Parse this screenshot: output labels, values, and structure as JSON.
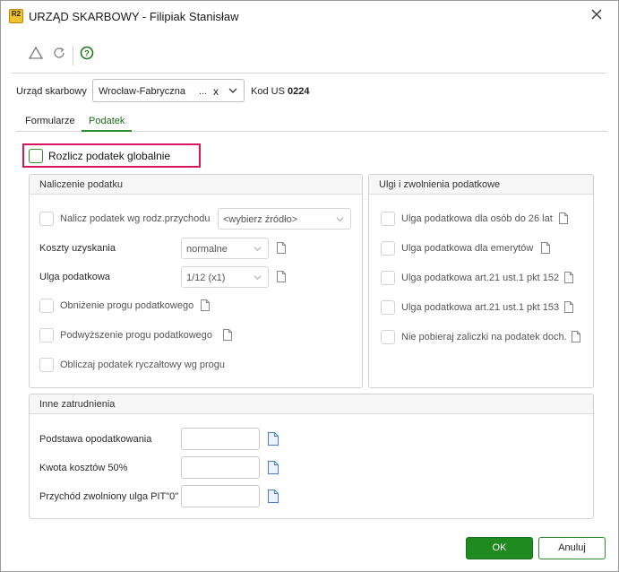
{
  "window": {
    "title": "URZĄD SKARBOWY - Filipiak Stanisław",
    "logo_text": "R2"
  },
  "header": {
    "us_label": "Urząd skarbowy",
    "us_value": "Wrocław-Fabryczna",
    "us_ellipsis": "...",
    "us_clear": "x",
    "kod_label": "Kod US",
    "kod_value": "0224"
  },
  "tabs": [
    {
      "label": "Formularze"
    },
    {
      "label": "Podatek"
    }
  ],
  "global": {
    "label": "Rozlicz podatek globalnie",
    "highlight_color": "#d6175f"
  },
  "naliczenie": {
    "title": "Naliczenie podatku",
    "wg_rodz_label": "Nalicz podatek wg rodz.przychodu",
    "zrodlo_value": "<wybierz źródło>",
    "koszty_label": "Koszty uzyskania",
    "koszty_value": "normalne",
    "ulga_label": "Ulga podatkowa",
    "ulga_value": "1/12 (x1)",
    "obnizenie_label": "Obniżenie progu podatkowego",
    "podwyzszenie_label": "Podwyższenie progu podatkowego",
    "ryczaltowy_label": "Obliczaj podatek ryczałtowy wg progu"
  },
  "ulgi": {
    "title": "Ulgi i zwolnienia podatkowe",
    "items": [
      {
        "label": "Ulga podatkowa dla osób do 26 lat"
      },
      {
        "label": "Ulga podatkowa dla emerytów"
      },
      {
        "label": "Ulga podatkowa art.21 ust.1 pkt 152"
      },
      {
        "label": "Ulga podatkowa art.21 ust.1 pkt 153"
      },
      {
        "label": "Nie pobieraj zaliczki na podatek doch."
      }
    ]
  },
  "inne": {
    "title": "Inne zatrudnienia",
    "podstawa_label": "Podstawa opodatkowania",
    "kwota_label": "Kwota kosztów 50%",
    "przychod_label": "Przychód zwolniony ulga PIT\"0\""
  },
  "buttons": {
    "ok": "OK",
    "cancel": "Anuluj"
  },
  "colors": {
    "accent": "#2e8b2e",
    "ok_bg": "#1f8a1f"
  },
  "icons": [
    "warning-triangle-icon",
    "refresh-icon",
    "help-icon",
    "close-icon",
    "chevron-down-icon",
    "document-icon"
  ]
}
